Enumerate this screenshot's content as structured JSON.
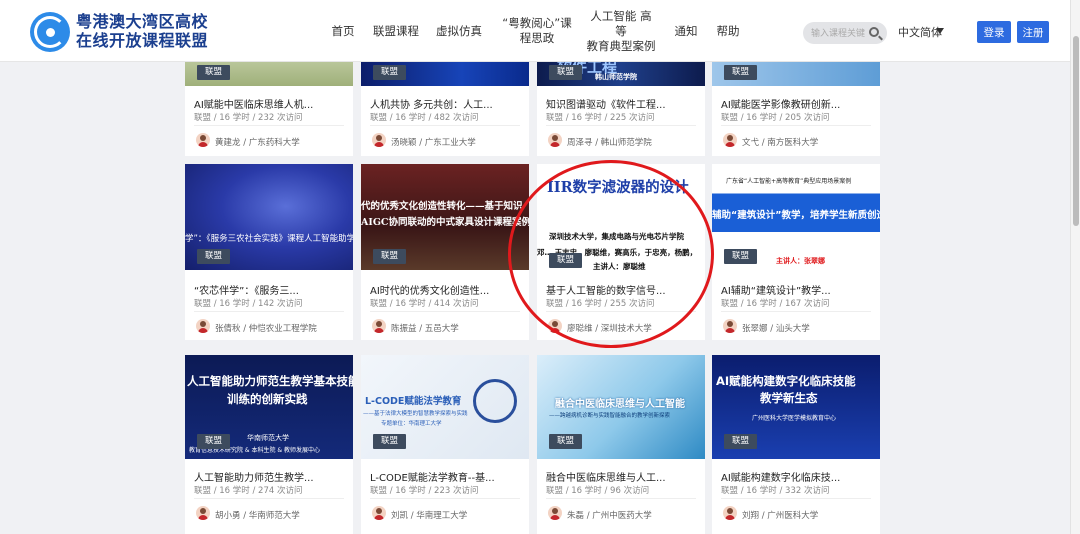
{
  "header": {
    "logo_line1": "粤港澳大湾区高校",
    "logo_line2": "在线开放课程联盟",
    "nav": [
      {
        "line1": "首页",
        "line2": ""
      },
      {
        "line1": "联盟课程",
        "line2": ""
      },
      {
        "line1": "虚拟仿真",
        "line2": ""
      },
      {
        "line1": "“粤教阅心”课",
        "line2": "程思政"
      },
      {
        "line1": "人工智能 高等",
        "line2": "教育典型案例"
      },
      {
        "line1": "通知",
        "line2": ""
      },
      {
        "line1": "帮助",
        "line2": ""
      }
    ],
    "search_placeholder": "输入课程关键",
    "language": "中文简体",
    "login": "登录",
    "register": "注册"
  },
  "courses": [
    {
      "badge": "联盟",
      "title": "AI赋能中医临床思维人机...",
      "meta": "联盟 / 16 学时 / 232 次访问",
      "author": "黄建龙 / 广东药科大学",
      "thumb_text": []
    },
    {
      "badge": "联盟",
      "title": "人机共协 多元共创：人工...",
      "meta": "联盟 / 16 学时 / 482 次访问",
      "author": "汤晓颖 / 广东工业大学",
      "thumb_text": []
    },
    {
      "badge": "联盟",
      "title": "知识图谱驱动《软件工程...",
      "meta": "联盟 / 16 学时 / 225 次访问",
      "author": "周泽寻 / 韩山师范学院",
      "thumb_text": [
        "软件工程",
        "韩山师范学院"
      ]
    },
    {
      "badge": "联盟",
      "title": "AI赋能医学影像教研创新...",
      "meta": "联盟 / 16 学时 / 205 次访问",
      "author": "文弋 / 南方医科大学",
      "thumb_text": []
    },
    {
      "badge": "联盟",
      "title": "“农芯伴学”：《服务三...",
      "meta": "联盟 / 16 学时 / 142 次访问",
      "author": "张倩秋 / 仲恺农业工程学院",
      "thumb_text": [
        "学”：《服务三农社会实践》课程人工智能助学"
      ]
    },
    {
      "badge": "联盟",
      "title": "AI时代的优秀文化创造性...",
      "meta": "联盟 / 16 学时 / 414 次访问",
      "author": "陈振益 / 五邑大学",
      "thumb_text": [
        "代的优秀文化创造性转化——基于知识",
        "AIGC协同联动的中式家具设计课程案例研"
      ]
    },
    {
      "badge": "联盟",
      "title": "基于人工智能的数字信号...",
      "meta": "联盟 / 16 学时 / 255 次访问",
      "author": "廖聪维 / 深圳技术大学",
      "thumb_text": [
        "IIR数字滤波器的设计",
        "深圳技术大学，集成电路与光电芯片学院",
        "邓… 王志忠，廖聪维，赛高乐，于忠亮，杨鹏，",
        "主讲人：廖聪维"
      ]
    },
    {
      "badge": "联盟",
      "title": "AI辅助“建筑设计”教学...",
      "meta": "联盟 / 16 学时 / 167 次访问",
      "author": "张翠娜 / 汕头大学",
      "thumb_text": [
        "广东省“人工智能+高等教育”典型应用场景案例",
        "辅助“建筑设计”教学，培养学生新质创造",
        "主讲人：张翠娜"
      ]
    },
    {
      "badge": "联盟",
      "title": "人工智能助力师范生教学...",
      "meta": "联盟 / 16 学时 / 274 次访问",
      "author": "胡小勇 / 华南师范大学",
      "thumb_text": [
        "人工智能助力师范生教学基本技能",
        "训练的创新实践",
        "华南师范大学",
        "教育信息技术研究院 & 本科生院 & 教师发展中心"
      ]
    },
    {
      "badge": "联盟",
      "title": "L-CODE赋能法学教育--基...",
      "meta": "联盟 / 16 学时 / 223 次访问",
      "author": "刘凯 / 华南理工大学",
      "thumb_text": [
        "L-CODE赋能法学教育",
        "——基于法律大模型的智慧教学探索与实践",
        "专题单位：华南理工大学"
      ]
    },
    {
      "badge": "联盟",
      "title": "融合中医临床思维与人工...",
      "meta": "联盟 / 16 学时 / 96 次访问",
      "author": "朱磊 / 广州中医药大学",
      "thumb_text": [
        "融合中医临床思维与人工智能",
        "——跨越病机诊断与实践智能融合的教学创新探索"
      ]
    },
    {
      "badge": "联盟",
      "title": "AI赋能构建数字化临床技...",
      "meta": "联盟 / 16 学时 / 332 次访问",
      "author": "刘翔 / 广州医科大学",
      "thumb_text": [
        "AI赋能构建数字化临床技能",
        "教学新生态",
        "广州医科大学医学模拟教育中心"
      ]
    }
  ]
}
